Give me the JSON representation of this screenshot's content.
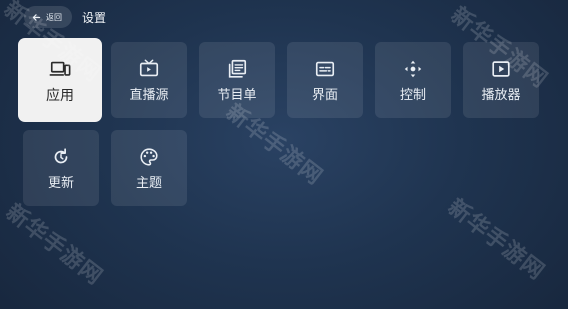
{
  "header": {
    "back_label": "返回",
    "title": "设置"
  },
  "tiles": [
    {
      "id": "app",
      "label": "应用",
      "icon": "devices-icon",
      "selected": true
    },
    {
      "id": "live-source",
      "label": "直播源",
      "icon": "tv-icon",
      "selected": false
    },
    {
      "id": "program-list",
      "label": "节目单",
      "icon": "library-icon",
      "selected": false
    },
    {
      "id": "interface",
      "label": "界面",
      "icon": "subtitles-icon",
      "selected": false
    },
    {
      "id": "control",
      "label": "控制",
      "icon": "dpad-icon",
      "selected": false
    },
    {
      "id": "player",
      "label": "播放器",
      "icon": "play-box-icon",
      "selected": false
    },
    {
      "id": "update",
      "label": "更新",
      "icon": "refresh-icon",
      "selected": false
    },
    {
      "id": "theme",
      "label": "主题",
      "icon": "palette-icon",
      "selected": false
    }
  ],
  "watermark": "新华手游网"
}
